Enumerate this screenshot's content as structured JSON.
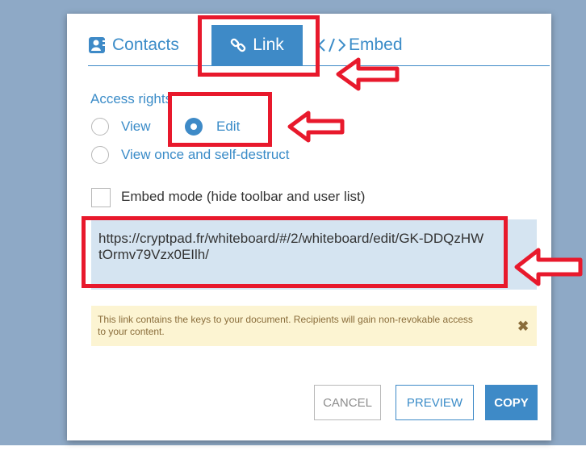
{
  "tabs": [
    {
      "label": "Contacts",
      "icon": "contacts-icon"
    },
    {
      "label": "Link",
      "icon": "link-icon"
    },
    {
      "label": "Embed",
      "icon": "embed-code-icon"
    }
  ],
  "access": {
    "label": "Access rights",
    "options": [
      {
        "label": "View",
        "checked": false
      },
      {
        "label": "Edit",
        "checked": true
      },
      {
        "label": "View once and self-destruct",
        "checked": false
      }
    ]
  },
  "embed_mode": {
    "label": "Embed mode (hide toolbar and user list)",
    "checked": false
  },
  "link": {
    "url": "https://cryptpad.fr/whiteboard/#/2/whiteboard/edit/GK-DDQzHWtOrmv79Vzx0EIlh/"
  },
  "warning": {
    "text": "This link contains the keys to your document. Recipients will gain non-revokable access to your content.",
    "close": "✖"
  },
  "buttons": {
    "cancel": "CANCEL",
    "preview": "PREVIEW",
    "copy": "COPY"
  },
  "colors": {
    "accent": "#3e8ac7",
    "highlight": "#e8192c",
    "warning_bg": "#fcf4d2",
    "url_bg": "#d5e4f1"
  }
}
